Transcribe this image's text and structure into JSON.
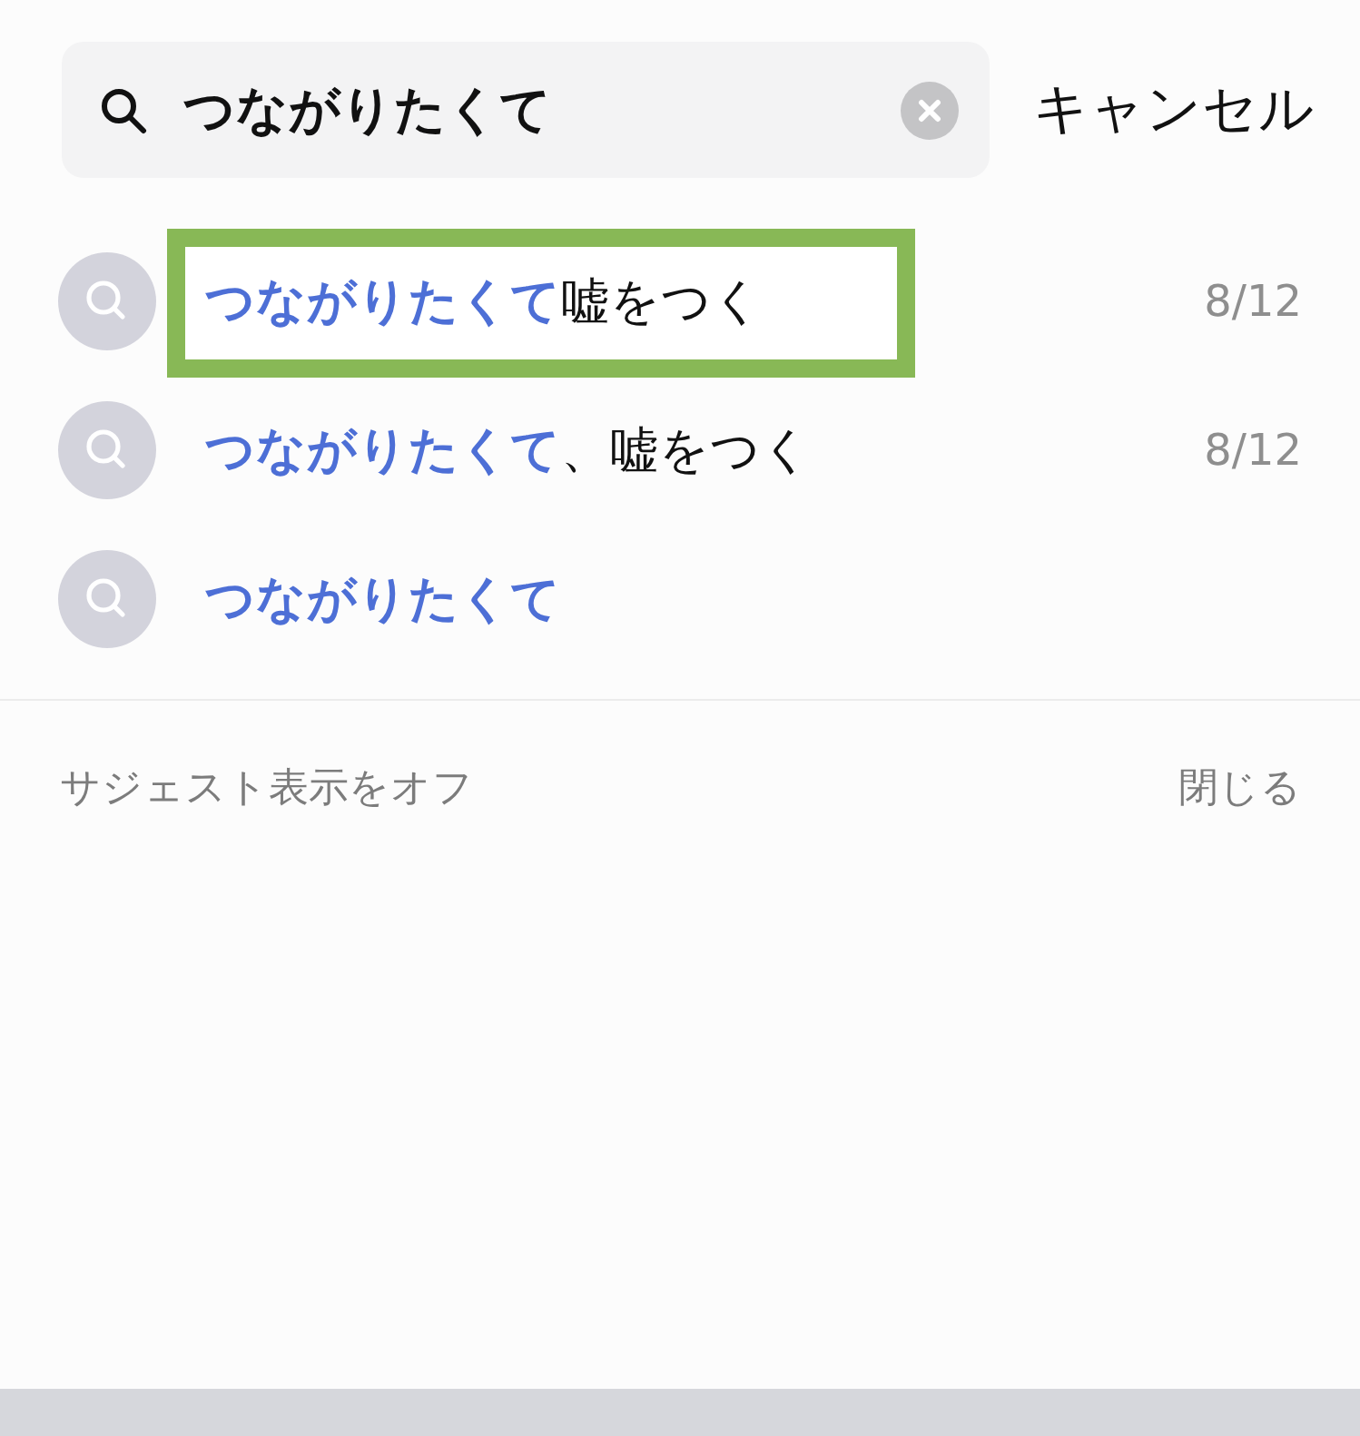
{
  "search": {
    "value": "つながりたくて",
    "cancel": "キャンセル"
  },
  "suggestions": [
    {
      "match": "つながりたくて",
      "rest": "嘘をつく",
      "date": "8/12",
      "outlined": true
    },
    {
      "match": "つながりたくて",
      "rest": "、嘘をつく",
      "date": "8/12",
      "outlined": false
    },
    {
      "match": "つながりたくて",
      "outlined": false
    }
  ],
  "footer": {
    "toggle": "サジェスト表示をオフ",
    "close": "閉じる"
  }
}
